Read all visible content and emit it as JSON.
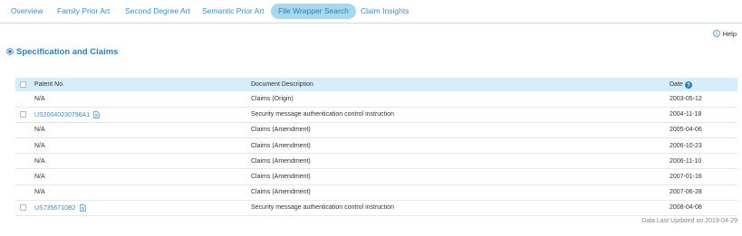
{
  "tabs": [
    {
      "label": "Overview",
      "active": false
    },
    {
      "label": "Family Prior Art",
      "active": false
    },
    {
      "label": "Second Degree Art",
      "active": false
    },
    {
      "label": "Semantic Prior Art",
      "active": false
    },
    {
      "label": "File Wrapper Search",
      "active": true
    },
    {
      "label": "Claim Insights",
      "active": false
    }
  ],
  "help": {
    "label": "Help",
    "icon": "info-icon"
  },
  "section": {
    "title": "Specification and Claims",
    "icon": "radio-selected-icon"
  },
  "table": {
    "columns": {
      "patent": "Patent No.",
      "description": "Document Description",
      "date": "Date",
      "date_help_icon": "question-icon"
    },
    "rows": [
      {
        "patent": "N/A",
        "description": "Claims (Origin)",
        "date": "2003-05-12",
        "checkbox": false,
        "link": false
      },
      {
        "patent": "US20040230796A1",
        "description": "Security message authentication control instruction",
        "date": "2004-11-18",
        "checkbox": true,
        "link": true
      },
      {
        "patent": "N/A",
        "description": "Claims (Amendment)",
        "date": "2005-04-06",
        "checkbox": false,
        "link": false
      },
      {
        "patent": "N/A",
        "description": "Claims (Amendment)",
        "date": "2006-10-23",
        "checkbox": false,
        "link": false
      },
      {
        "patent": "N/A",
        "description": "Claims (Amendment)",
        "date": "2006-11-10",
        "checkbox": false,
        "link": false
      },
      {
        "patent": "N/A",
        "description": "Claims (Amendment)",
        "date": "2007-01-16",
        "checkbox": false,
        "link": false
      },
      {
        "patent": "N/A",
        "description": "Claims (Amendment)",
        "date": "2007-06-28",
        "checkbox": false,
        "link": false
      },
      {
        "patent": "US7356710B2",
        "description": "Security message authentication control instruction",
        "date": "2008-04-08",
        "checkbox": true,
        "link": true
      }
    ]
  },
  "footer": {
    "text": "Data Last Updated on 2019-04-29"
  },
  "colors": {
    "accent": "#3a8fc7",
    "active_tab_bg": "#a9d7ee",
    "header_bg": "#d6eef9"
  }
}
